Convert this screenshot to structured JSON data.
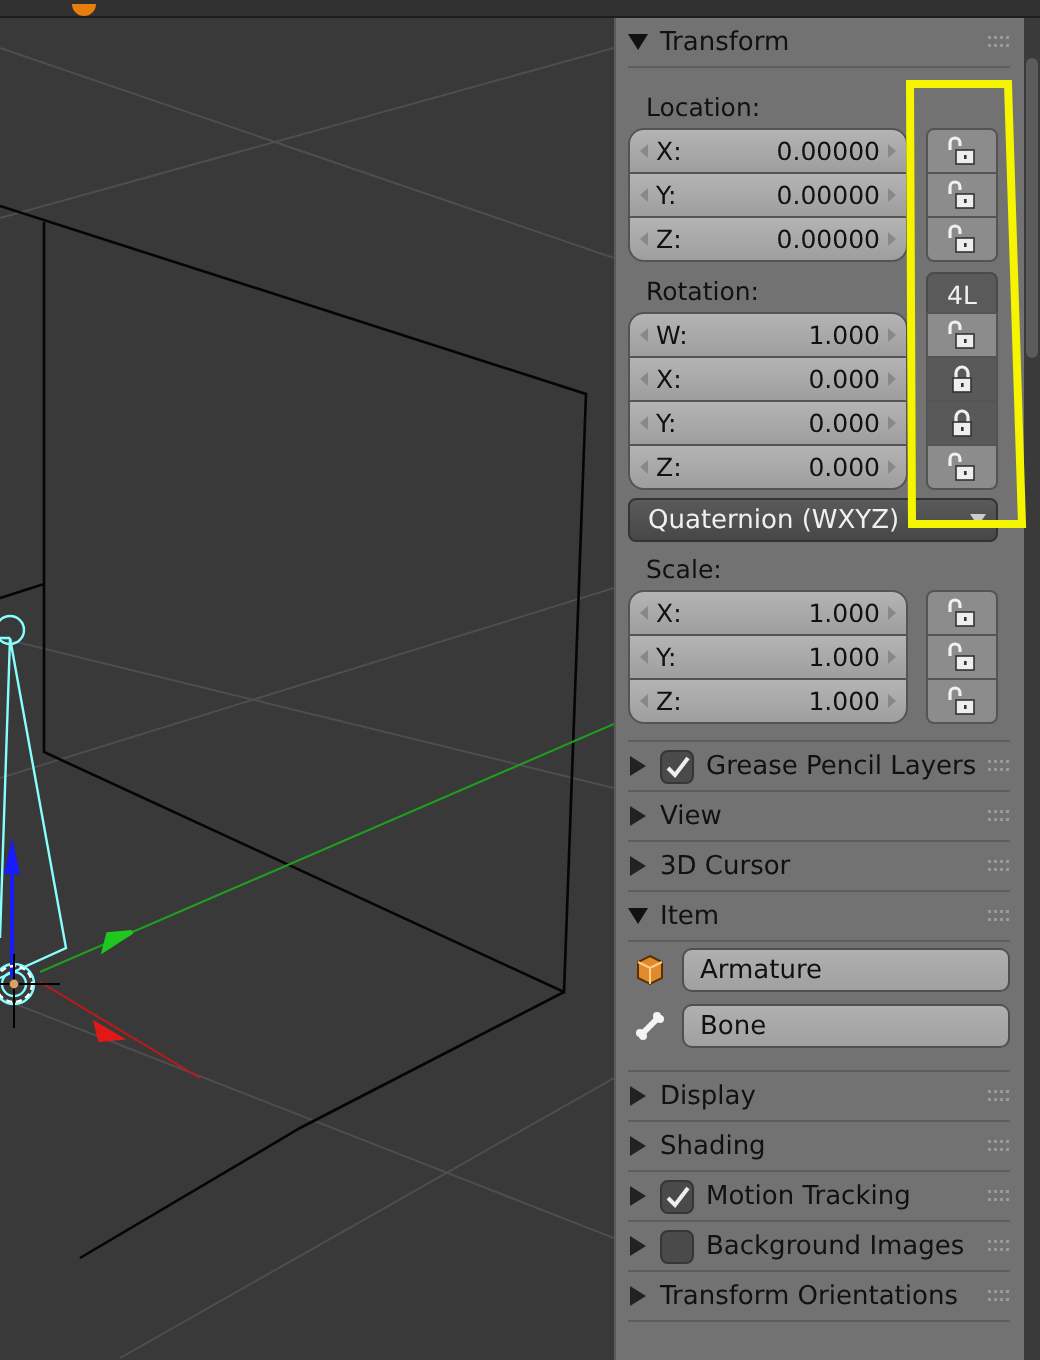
{
  "transform": {
    "title": "Transform",
    "expanded": true,
    "location": {
      "label": "Location:",
      "fields": [
        {
          "axis": "X:",
          "value": "0.00000",
          "locked": false
        },
        {
          "axis": "Y:",
          "value": "0.00000",
          "locked": false
        },
        {
          "axis": "Z:",
          "value": "0.00000",
          "locked": false
        }
      ]
    },
    "rotation": {
      "label": "Rotation:",
      "lock_mode": "4L",
      "fields": [
        {
          "axis": "W:",
          "value": "1.000",
          "locked": false
        },
        {
          "axis": "X:",
          "value": "0.000",
          "locked": true
        },
        {
          "axis": "Y:",
          "value": "0.000",
          "locked": true
        },
        {
          "axis": "Z:",
          "value": "0.000",
          "locked": false
        }
      ]
    },
    "rotation_mode": "Quaternion (WXYZ)",
    "scale": {
      "label": "Scale:",
      "fields": [
        {
          "axis": "X:",
          "value": "1.000",
          "locked": false
        },
        {
          "axis": "Y:",
          "value": "1.000",
          "locked": false
        },
        {
          "axis": "Z:",
          "value": "1.000",
          "locked": false
        }
      ]
    }
  },
  "panels": [
    {
      "kind": "checkbox",
      "title": "Grease Pencil Layers",
      "expanded": false,
      "checked": true
    },
    {
      "kind": "plain",
      "title": "View",
      "expanded": false
    },
    {
      "kind": "plain",
      "title": "3D Cursor",
      "expanded": false
    },
    {
      "kind": "item",
      "title": "Item",
      "expanded": true,
      "object_name": "Armature",
      "bone_name": "Bone"
    },
    {
      "kind": "plain",
      "title": "Display",
      "expanded": false
    },
    {
      "kind": "plain",
      "title": "Shading",
      "expanded": false
    },
    {
      "kind": "checkbox",
      "title": "Motion Tracking",
      "expanded": false,
      "checked": true
    },
    {
      "kind": "checkbox",
      "title": "Background Images",
      "expanded": false,
      "checked": false
    },
    {
      "kind": "plain",
      "title": "Transform Orientations",
      "expanded": false
    }
  ]
}
